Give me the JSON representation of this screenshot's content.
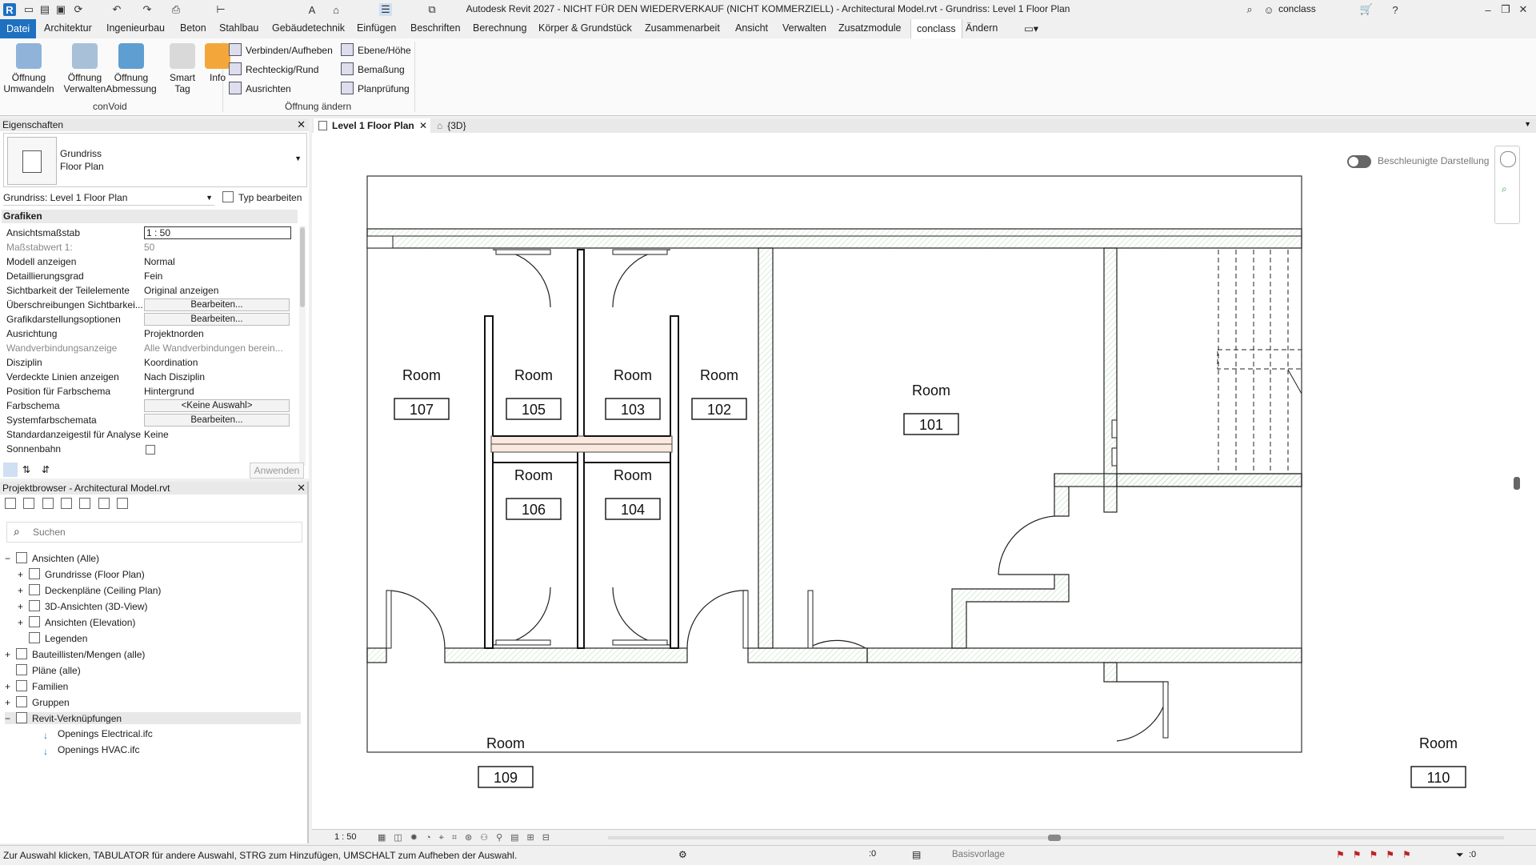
{
  "titlebar": {
    "title": "Autodesk Revit 2027 - NICHT FÜR DEN WIEDERVERKAUF (NICHT KOMMERZIELL) - Architectural Model.rvt - Grundriss: Level 1 Floor Plan",
    "user": "conclass",
    "app_logo": "R"
  },
  "menu": [
    "Datei",
    "Architektur",
    "Ingenieurbau",
    "Beton",
    "Stahlbau",
    "Gebäudetechnik",
    "Einfügen",
    "Beschriften",
    "Berechnung",
    "Körper & Grundstück",
    "Zusammenarbeit",
    "Ansicht",
    "Verwalten",
    "Zusatzmodule",
    "conclass",
    "Ändern"
  ],
  "ribbon": {
    "big_buttons": [
      {
        "line1": "Öffnung",
        "line2": "Umwandeln",
        "icon": "opening-convert-icon"
      },
      {
        "line1": "Öffnung",
        "line2": "Verwalten",
        "icon": "opening-manage-icon"
      },
      {
        "line1": "Öffnung",
        "line2": "Abmessung",
        "icon": "opening-dimension-icon"
      },
      {
        "line1": "Smart",
        "line2": "Tag",
        "icon": "smart-tag-icon"
      },
      {
        "line1": "Info",
        "line2": "",
        "icon": "info-icon"
      }
    ],
    "group1_label": "conVoid",
    "small_col1": [
      "Verbinden/Aufheben",
      "Rechteckig/Rund",
      "Ausrichten"
    ],
    "small_col2": [
      "Ebene/Höhe",
      "Bemaßung",
      "Planprüfung"
    ],
    "group2_label": "Öffnung ändern"
  },
  "properties": {
    "title": "Eigenschaften",
    "type_line1": "Grundriss",
    "type_line2": "Floor Plan",
    "view_selector": "Grundriss: Level 1 Floor Plan",
    "edit_type": "Typ bearbeiten",
    "section": "Grafiken",
    "apply": "Anwenden",
    "rows": [
      {
        "k": "Ansichtsmaßstab",
        "v": "1 : 50"
      },
      {
        "k": "Maßstabwert 1:",
        "v": "50"
      },
      {
        "k": "Modell anzeigen",
        "v": "Normal"
      },
      {
        "k": "Detaillierungsgrad",
        "v": "Fein"
      },
      {
        "k": "Sichtbarkeit der Teilelemente",
        "v": "Original anzeigen"
      },
      {
        "k": "Überschreibungen Sichtbarkei...",
        "v": "Bearbeiten..."
      },
      {
        "k": "Grafikdarstellungsoptionen",
        "v": "Bearbeiten..."
      },
      {
        "k": "Ausrichtung",
        "v": "Projektnorden"
      },
      {
        "k": "Wandverbindungsanzeige",
        "v": "Alle Wandverbindungen berein..."
      },
      {
        "k": "Disziplin",
        "v": "Koordination"
      },
      {
        "k": "Verdeckte Linien anzeigen",
        "v": "Nach Disziplin"
      },
      {
        "k": "Position für Farbschema",
        "v": "Hintergrund"
      },
      {
        "k": "Farbschema",
        "v": "<Keine Auswahl>"
      },
      {
        "k": "Systemfarbschemata",
        "v": "Bearbeiten..."
      },
      {
        "k": "Standardanzeigestil für Analyse",
        "v": "Keine"
      },
      {
        "k": "Sonnenbahn",
        "v": ""
      }
    ]
  },
  "browser": {
    "title": "Projektbrowser - Architectural Model.rvt",
    "search_placeholder": "Suchen",
    "items": [
      "Ansichten (Alle)",
      "Grundrisse (Floor Plan)",
      "Deckenpläne (Ceiling Plan)",
      "3D-Ansichten (3D-View)",
      "Ansichten (Elevation)",
      "Legenden",
      "Bauteillisten/Mengen (alle)",
      "Pläne (alle)",
      "Familien",
      "Gruppen",
      "Revit-Verknüpfungen",
      "Openings Electrical.ifc",
      "Openings HVAC.ifc"
    ]
  },
  "tabs": {
    "active": "Level 1 Floor Plan",
    "other": "{3D}"
  },
  "canvas": {
    "accel_label": "Beschleunigte Darstellung",
    "room_word": "Room",
    "rooms": [
      "107",
      "105",
      "103",
      "102",
      "101",
      "106",
      "104",
      "109",
      "110"
    ]
  },
  "viewbar": {
    "scale": "1 : 50"
  },
  "status": {
    "hint": "Zur Auswahl klicken, TABULATOR für andere Auswahl, STRG zum Hinzufügen, UMSCHALT zum Aufheben der Auswahl.",
    "workset": ":0",
    "template": "Basisvorlage",
    "filter": ":0"
  }
}
